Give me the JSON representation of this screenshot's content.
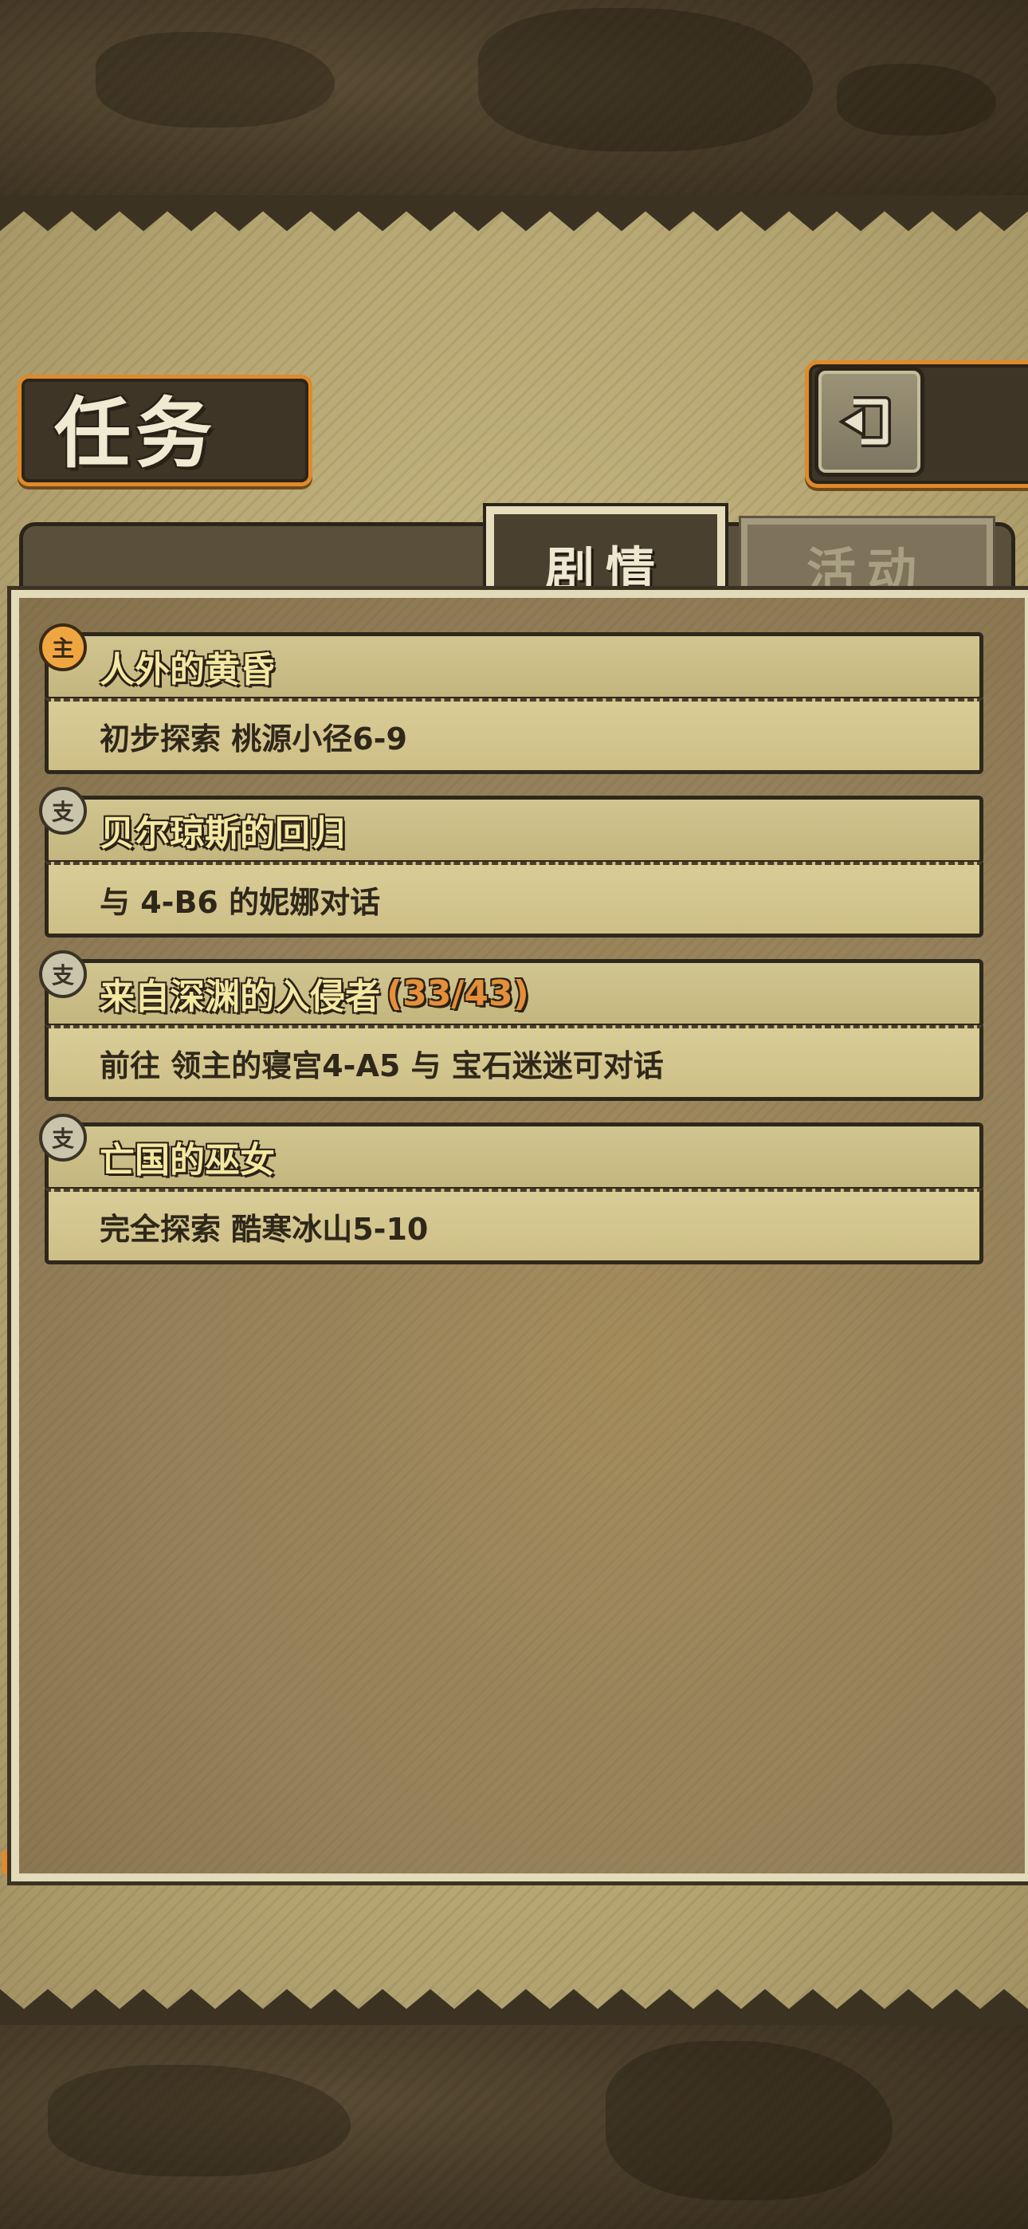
{
  "header": {
    "title": "任务",
    "back_icon": "return-arrow-icon"
  },
  "tabs": [
    {
      "label": "剧情",
      "active": true
    },
    {
      "label": "活动",
      "active": false
    }
  ],
  "quests": [
    {
      "badge": "主",
      "type": "main",
      "title": "人外的黄昏",
      "progress": "",
      "description": "初步探索 桃源小径6-9"
    },
    {
      "badge": "支",
      "type": "side",
      "title": "贝尔琼斯的回归",
      "progress": "",
      "description": "与 4-B6 的妮娜对话"
    },
    {
      "badge": "支",
      "type": "side",
      "title": "来自深渊的入侵者",
      "progress": "(33/43)",
      "description": "前往 领主的寝宫4-A5 与 宝石迷迷可对话"
    },
    {
      "badge": "支",
      "type": "side",
      "title": "亡国的巫女",
      "progress": "",
      "description": "完全探索 酷寒冰山5-10"
    }
  ],
  "colors": {
    "accent_orange": "#e08a2a",
    "title_yellow": "#f3e7a2",
    "progress_orange": "#e58f3a",
    "parchment": "#c9bd88"
  }
}
